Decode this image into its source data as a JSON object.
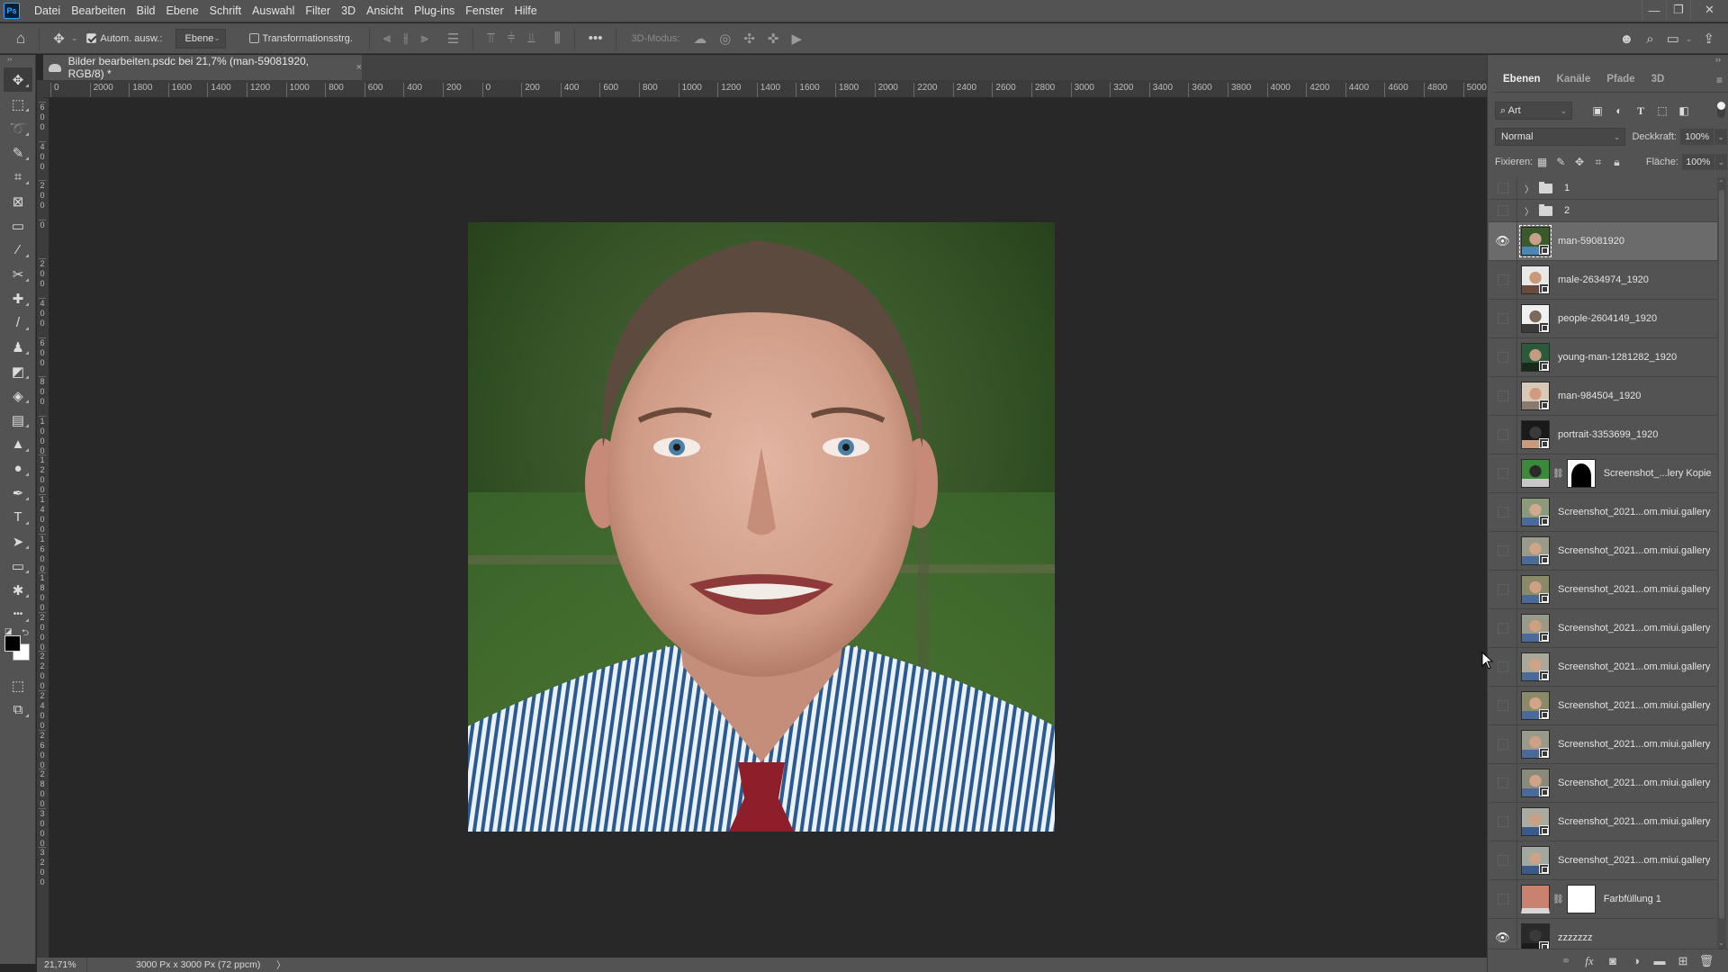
{
  "app": {
    "logo": "Ps"
  },
  "menu": [
    "Datei",
    "Bearbeiten",
    "Bild",
    "Ebene",
    "Schrift",
    "Auswahl",
    "Filter",
    "3D",
    "Ansicht",
    "Plug-ins",
    "Fenster",
    "Hilfe"
  ],
  "window_controls": {
    "minimize": "—",
    "restore": "❐",
    "close": "✕"
  },
  "options_bar": {
    "auto_select_label": "Autom. ausw.:",
    "auto_select_checked": true,
    "auto_select_target": "Ebene",
    "transform_controls_label": "Transformationsstrg.",
    "transform_controls_checked": false,
    "mode_3d_label": "3D-Modus:",
    "more_label": "•••"
  },
  "document_tab": {
    "title": "Bilder bearbeiten.psdc bei 21,7% (man-59081920, RGB/8) *",
    "close": "×"
  },
  "ruler_h": [
    "0",
    "2000",
    "1800",
    "1600",
    "1400",
    "1200",
    "1000",
    "800",
    "600",
    "400",
    "200",
    "0",
    "200",
    "400",
    "600",
    "800",
    "1000",
    "1200",
    "1400",
    "1600",
    "1800",
    "2000",
    "2200",
    "2400",
    "2600",
    "2800",
    "3000",
    "3200",
    "3400",
    "3600",
    "3800",
    "4000",
    "4200",
    "4400",
    "4600",
    "4800",
    "5000"
  ],
  "ruler_v": [
    "600",
    "400",
    "200",
    "0",
    "200",
    "400",
    "600",
    "800",
    "1000",
    "1200",
    "1400",
    "1600",
    "1800",
    "2000",
    "2200",
    "2400",
    "2600",
    "2800",
    "3000",
    "3200"
  ],
  "tools": [
    {
      "name": "move-tool",
      "glyph": "✥",
      "active": true
    },
    {
      "name": "marquee-tool",
      "glyph": "⬚"
    },
    {
      "name": "lasso-tool",
      "glyph": "➰"
    },
    {
      "name": "quick-selection-tool",
      "glyph": "✎"
    },
    {
      "name": "crop-tool",
      "glyph": "⌗"
    },
    {
      "name": "frame-tool",
      "glyph": "⊠"
    },
    {
      "name": "ruler-tool",
      "glyph": "▭"
    },
    {
      "name": "eyedropper-tool",
      "glyph": "⁄"
    },
    {
      "name": "content-aware-move-tool",
      "glyph": "✂"
    },
    {
      "name": "healing-brush-tool",
      "glyph": "✚"
    },
    {
      "name": "brush-tool",
      "glyph": "/"
    },
    {
      "name": "clone-stamp-tool",
      "glyph": "♟"
    },
    {
      "name": "eraser-tool",
      "glyph": "◩"
    },
    {
      "name": "paint-bucket-tool",
      "glyph": "◈"
    },
    {
      "name": "gradient-tool",
      "glyph": "▤"
    },
    {
      "name": "blur-tool",
      "glyph": "▲"
    },
    {
      "name": "dodge-tool",
      "glyph": "●"
    },
    {
      "name": "pen-tool",
      "glyph": "✒"
    },
    {
      "name": "type-tool",
      "glyph": "T"
    },
    {
      "name": "path-selection-tool",
      "glyph": "➤"
    },
    {
      "name": "rectangle-tool",
      "glyph": "▭"
    },
    {
      "name": "custom-shape-tool",
      "glyph": "✱"
    },
    {
      "name": "more-tools",
      "glyph": "•••"
    }
  ],
  "colors": {
    "foreground": "#000000",
    "background": "#ffffff",
    "panel_bg": "#535353",
    "canvas_bg": "#282828",
    "selected_layer": "#6b6b6b",
    "fill_layer_color": "#c98270"
  },
  "status": {
    "zoom": "21,71%",
    "doc_info": "3000 Px x 3000 Px (72 ppcm)",
    "arrow": "〉"
  },
  "panel": {
    "tabs": [
      "Ebenen",
      "Kanäle",
      "Pfade",
      "3D"
    ],
    "active_tab": "Ebenen",
    "filter_kind": "Art",
    "blend_mode": "Normal",
    "opacity_label": "Deckkraft:",
    "opacity_value": "100%",
    "lock_label": "Fixieren:",
    "fill_label": "Fläche:",
    "fill_value": "100%"
  },
  "layers": [
    {
      "type": "group",
      "name": "1",
      "visible": false
    },
    {
      "type": "group",
      "name": "2",
      "visible": false
    },
    {
      "type": "smart",
      "name": "man-59081920",
      "visible": true,
      "selected": true,
      "thumb": [
        "#3a5a2c",
        "#c9a08c",
        "#4a86b8"
      ]
    },
    {
      "type": "smart",
      "name": "male-2634974_1920",
      "visible": false,
      "thumb": [
        "#e8e8e8",
        "#c89a7a",
        "#6a4a3a"
      ]
    },
    {
      "type": "smart",
      "name": "people-2604149_1920",
      "visible": false,
      "thumb": [
        "#f0f0f0",
        "#7a6a5a",
        "#3a3a3a"
      ]
    },
    {
      "type": "smart",
      "name": "young-man-1281282_1920",
      "visible": false,
      "thumb": [
        "#2a5a3a",
        "#c49a80",
        "#1a2a1a"
      ]
    },
    {
      "type": "smart",
      "name": "man-984504_1920",
      "visible": false,
      "thumb": [
        "#d8c8b8",
        "#d49a80",
        "#8a7a6a"
      ]
    },
    {
      "type": "smart",
      "name": "portrait-3353699_1920",
      "visible": false,
      "thumb": [
        "#1a1a1a",
        "#3a3a3a",
        "#c89a7a"
      ]
    },
    {
      "type": "masked",
      "name": "Screenshot_...lery Kopie",
      "visible": false,
      "thumb": [
        "#3a8a3a",
        "#2a2a2a",
        "#c8c8c8"
      ]
    },
    {
      "type": "smart",
      "name": "Screenshot_2021...om.miui.gallery",
      "visible": false,
      "thumb": [
        "#8a9a7a",
        "#d4a88c",
        "#4a6a9a"
      ]
    },
    {
      "type": "smart",
      "name": "Screenshot_2021...om.miui.gallery",
      "visible": false,
      "thumb": [
        "#9a9a8a",
        "#d0a488",
        "#4a6a9a"
      ]
    },
    {
      "type": "smart",
      "name": "Screenshot_2021...om.miui.gallery",
      "visible": false,
      "thumb": [
        "#8a8a6a",
        "#cfa084",
        "#4a6a9a"
      ]
    },
    {
      "type": "smart",
      "name": "Screenshot_2021...om.miui.gallery",
      "visible": false,
      "thumb": [
        "#9a9a8a",
        "#cf9f82",
        "#4a6a9a"
      ]
    },
    {
      "type": "smart",
      "name": "Screenshot_2021...om.miui.gallery",
      "visible": false,
      "thumb": [
        "#aaa89a",
        "#d0a286",
        "#4a6a9a"
      ]
    },
    {
      "type": "smart",
      "name": "Screenshot_2021...om.miui.gallery",
      "visible": false,
      "thumb": [
        "#8a8a6a",
        "#d2a488",
        "#4a6a9a"
      ]
    },
    {
      "type": "smart",
      "name": "Screenshot_2021...om.miui.gallery",
      "visible": false,
      "thumb": [
        "#9a9a8a",
        "#cfa084",
        "#4a6a9a"
      ]
    },
    {
      "type": "smart",
      "name": "Screenshot_2021...om.miui.gallery",
      "visible": false,
      "thumb": [
        "#8a8a7a",
        "#d0a286",
        "#4a6a9a"
      ]
    },
    {
      "type": "smart",
      "name": "Screenshot_2021...om.miui.gallery",
      "visible": false,
      "thumb": [
        "#aaaaa0",
        "#caa084",
        "#3a5a8a"
      ]
    },
    {
      "type": "smart",
      "name": "Screenshot_2021...om.miui.gallery",
      "visible": false,
      "thumb": [
        "#a0a8a0",
        "#cda286",
        "#3a5a8a"
      ]
    },
    {
      "type": "fill",
      "name": "Farbfüllung 1",
      "visible": false
    },
    {
      "type": "smart",
      "name": "zzzzzzz",
      "visible": true,
      "thumb": [
        "#2a2a2a",
        "#3a3a3a",
        "#1a1a1a"
      ]
    }
  ],
  "layer_footer": [
    "link-layers",
    "fx",
    "add-mask",
    "adjustment-layer",
    "new-group",
    "new-layer",
    "delete-layer"
  ],
  "canvas_image": {
    "subject": "Portrait of smiling man in striped shirt with red tie, green blurred background"
  }
}
